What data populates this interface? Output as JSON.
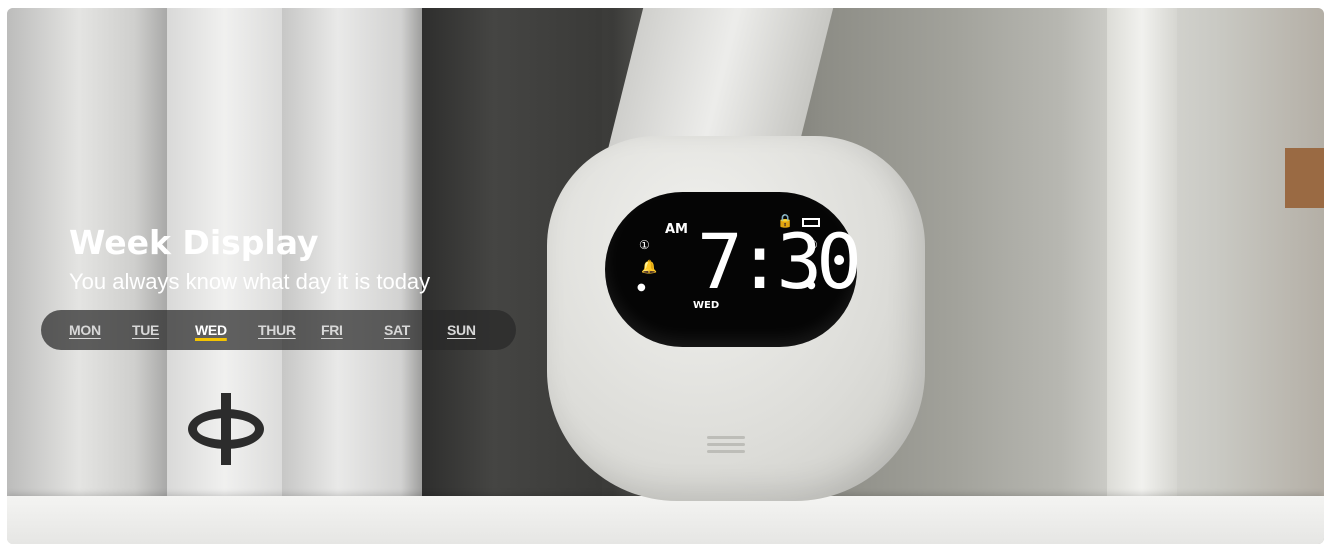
{
  "banner": {
    "title": "Week Display",
    "subtitle": "You always know what day it is today"
  },
  "days": [
    {
      "label": "MON",
      "active": false
    },
    {
      "label": "TUE",
      "active": false
    },
    {
      "label": "WED",
      "active": true
    },
    {
      "label": "THUR",
      "active": false
    },
    {
      "label": "FRI",
      "active": false
    },
    {
      "label": "SAT",
      "active": false
    },
    {
      "label": "SUN",
      "active": false
    }
  ],
  "accent_color": "#f3c300",
  "clock_display": {
    "period": "AM",
    "time": "7:30",
    "day": "WED"
  },
  "icons": [
    "alarm-1-icon",
    "alarm-2-icon",
    "bell-icon",
    "lock-icon",
    "battery-icon",
    "radio-icon",
    "speaker-vent-icon"
  ]
}
